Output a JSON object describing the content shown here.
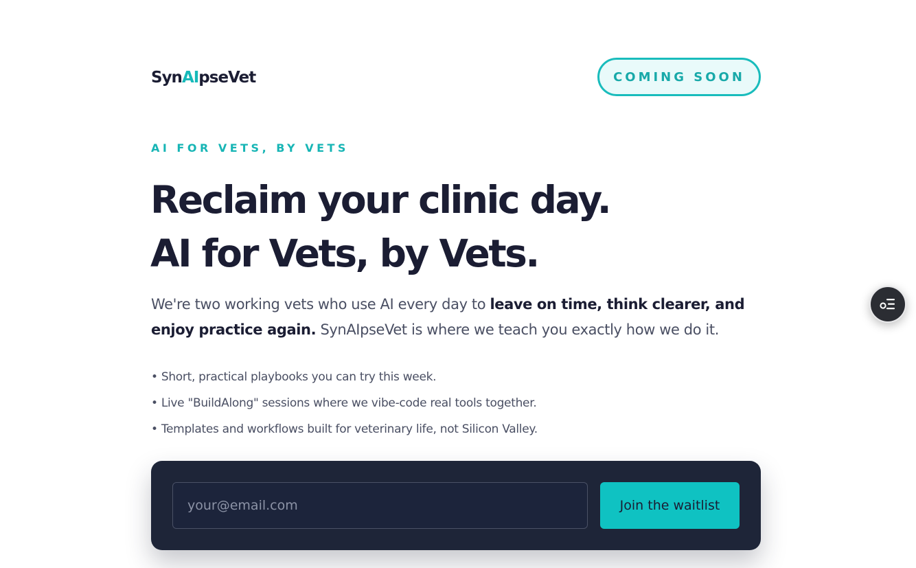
{
  "header": {
    "logo_part1": "Syn",
    "logo_part2": "AI",
    "logo_part3": "pseVet",
    "badge_label": "COMING SOON"
  },
  "hero": {
    "eyebrow": "AI FOR VETS, BY VETS",
    "headline_line1": "Reclaim your clinic day.",
    "headline_line2": "AI for Vets, by Vets.",
    "intro_part1": "We're two working vets who use AI every day to ",
    "intro_bold": "leave on time, think clearer, and enjoy practice again.",
    "intro_part2": " SynAIpseVet is where we teach you exactly how we do it."
  },
  "bullets": [
    "• Short, practical playbooks you can try this week.",
    "• Live \"BuildAlong\" sessions where we vibe-code real tools together.",
    "• Templates and workflows built for veterinary life, not Silicon Valley."
  ],
  "signup": {
    "email_placeholder": "your@email.com",
    "email_value": "",
    "submit_label": "Join the waitlist"
  },
  "floating_button": {
    "icon": "list-settings-icon"
  },
  "colors": {
    "accent": "#16b9b9",
    "text_dark": "#1b1d33",
    "panel": "#1e2538",
    "button": "#0fc2c2"
  }
}
